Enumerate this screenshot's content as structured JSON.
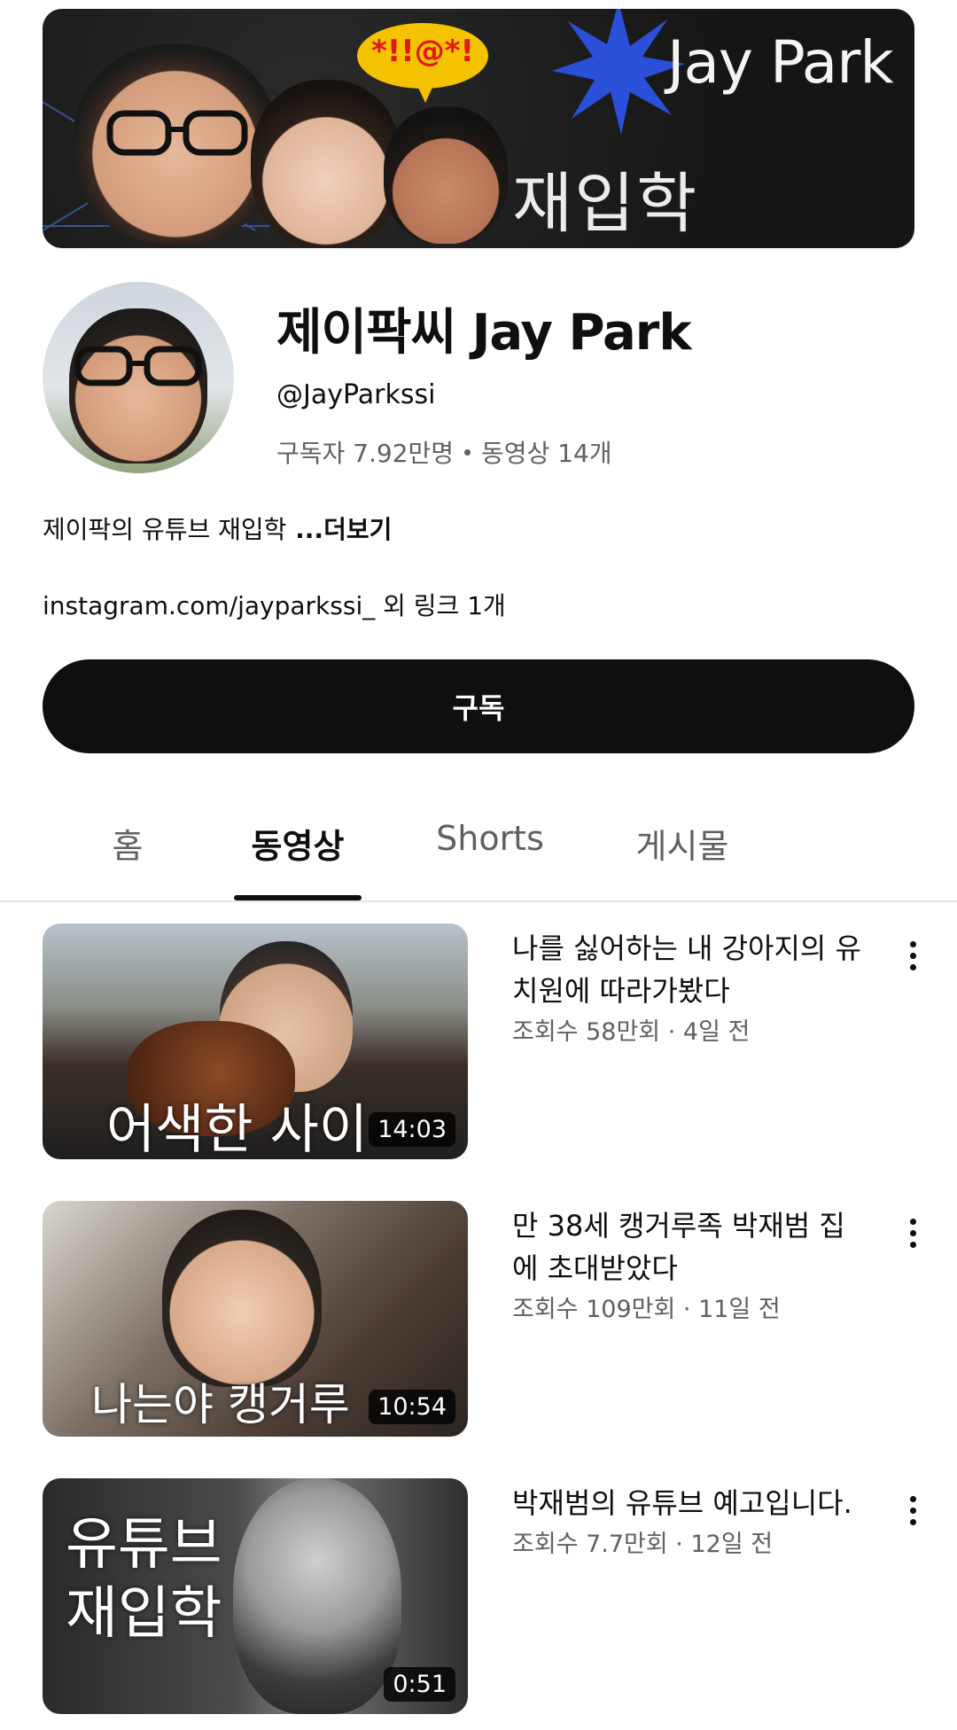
{
  "banner": {
    "title": "Jay Park",
    "subtitle": "재입학",
    "bubble_text": "*!!@*!"
  },
  "channel": {
    "name": "제이팍씨 Jay Park",
    "handle": "@JayParkssi",
    "subscribers": "구독자 7.92만명",
    "video_count": "동영상 14개",
    "description": "제이팍의 유튜브 재입학",
    "more": " ...더보기",
    "link": "instagram.com/jayparkssi_",
    "link_extra": " 외 링크 1개",
    "subscribe_label": "구독"
  },
  "tabs": [
    {
      "label": "홈"
    },
    {
      "label": "동영상"
    },
    {
      "label": "Shorts"
    },
    {
      "label": "게시물"
    }
  ],
  "active_tab": "동영상",
  "videos": [
    {
      "title": "나를 싫어하는 내 강아지의 유치원에 따라가봤다",
      "meta": "조회수 58만회 · 4일 전",
      "duration": "14:03",
      "thumb_caption": "어색한 사이"
    },
    {
      "title": "만 38세 캥거루족 박재범 집에 초대받았다",
      "meta": "조회수 109만회 · 11일 전",
      "duration": "10:54",
      "thumb_caption": "나는야 캥거루"
    },
    {
      "title": "박재범의 유튜브 예고입니다.",
      "meta": "조회수 7.7만회 · 12일 전",
      "duration": "0:51",
      "thumb_caption": "유튜브 재입학"
    }
  ],
  "colors": {
    "text_primary": "#0f0f0f",
    "text_secondary": "#606060",
    "subscribe_bg": "#0f0f0f",
    "banner_star": "#2a4fd8",
    "banner_bubble": "#f5c200"
  }
}
